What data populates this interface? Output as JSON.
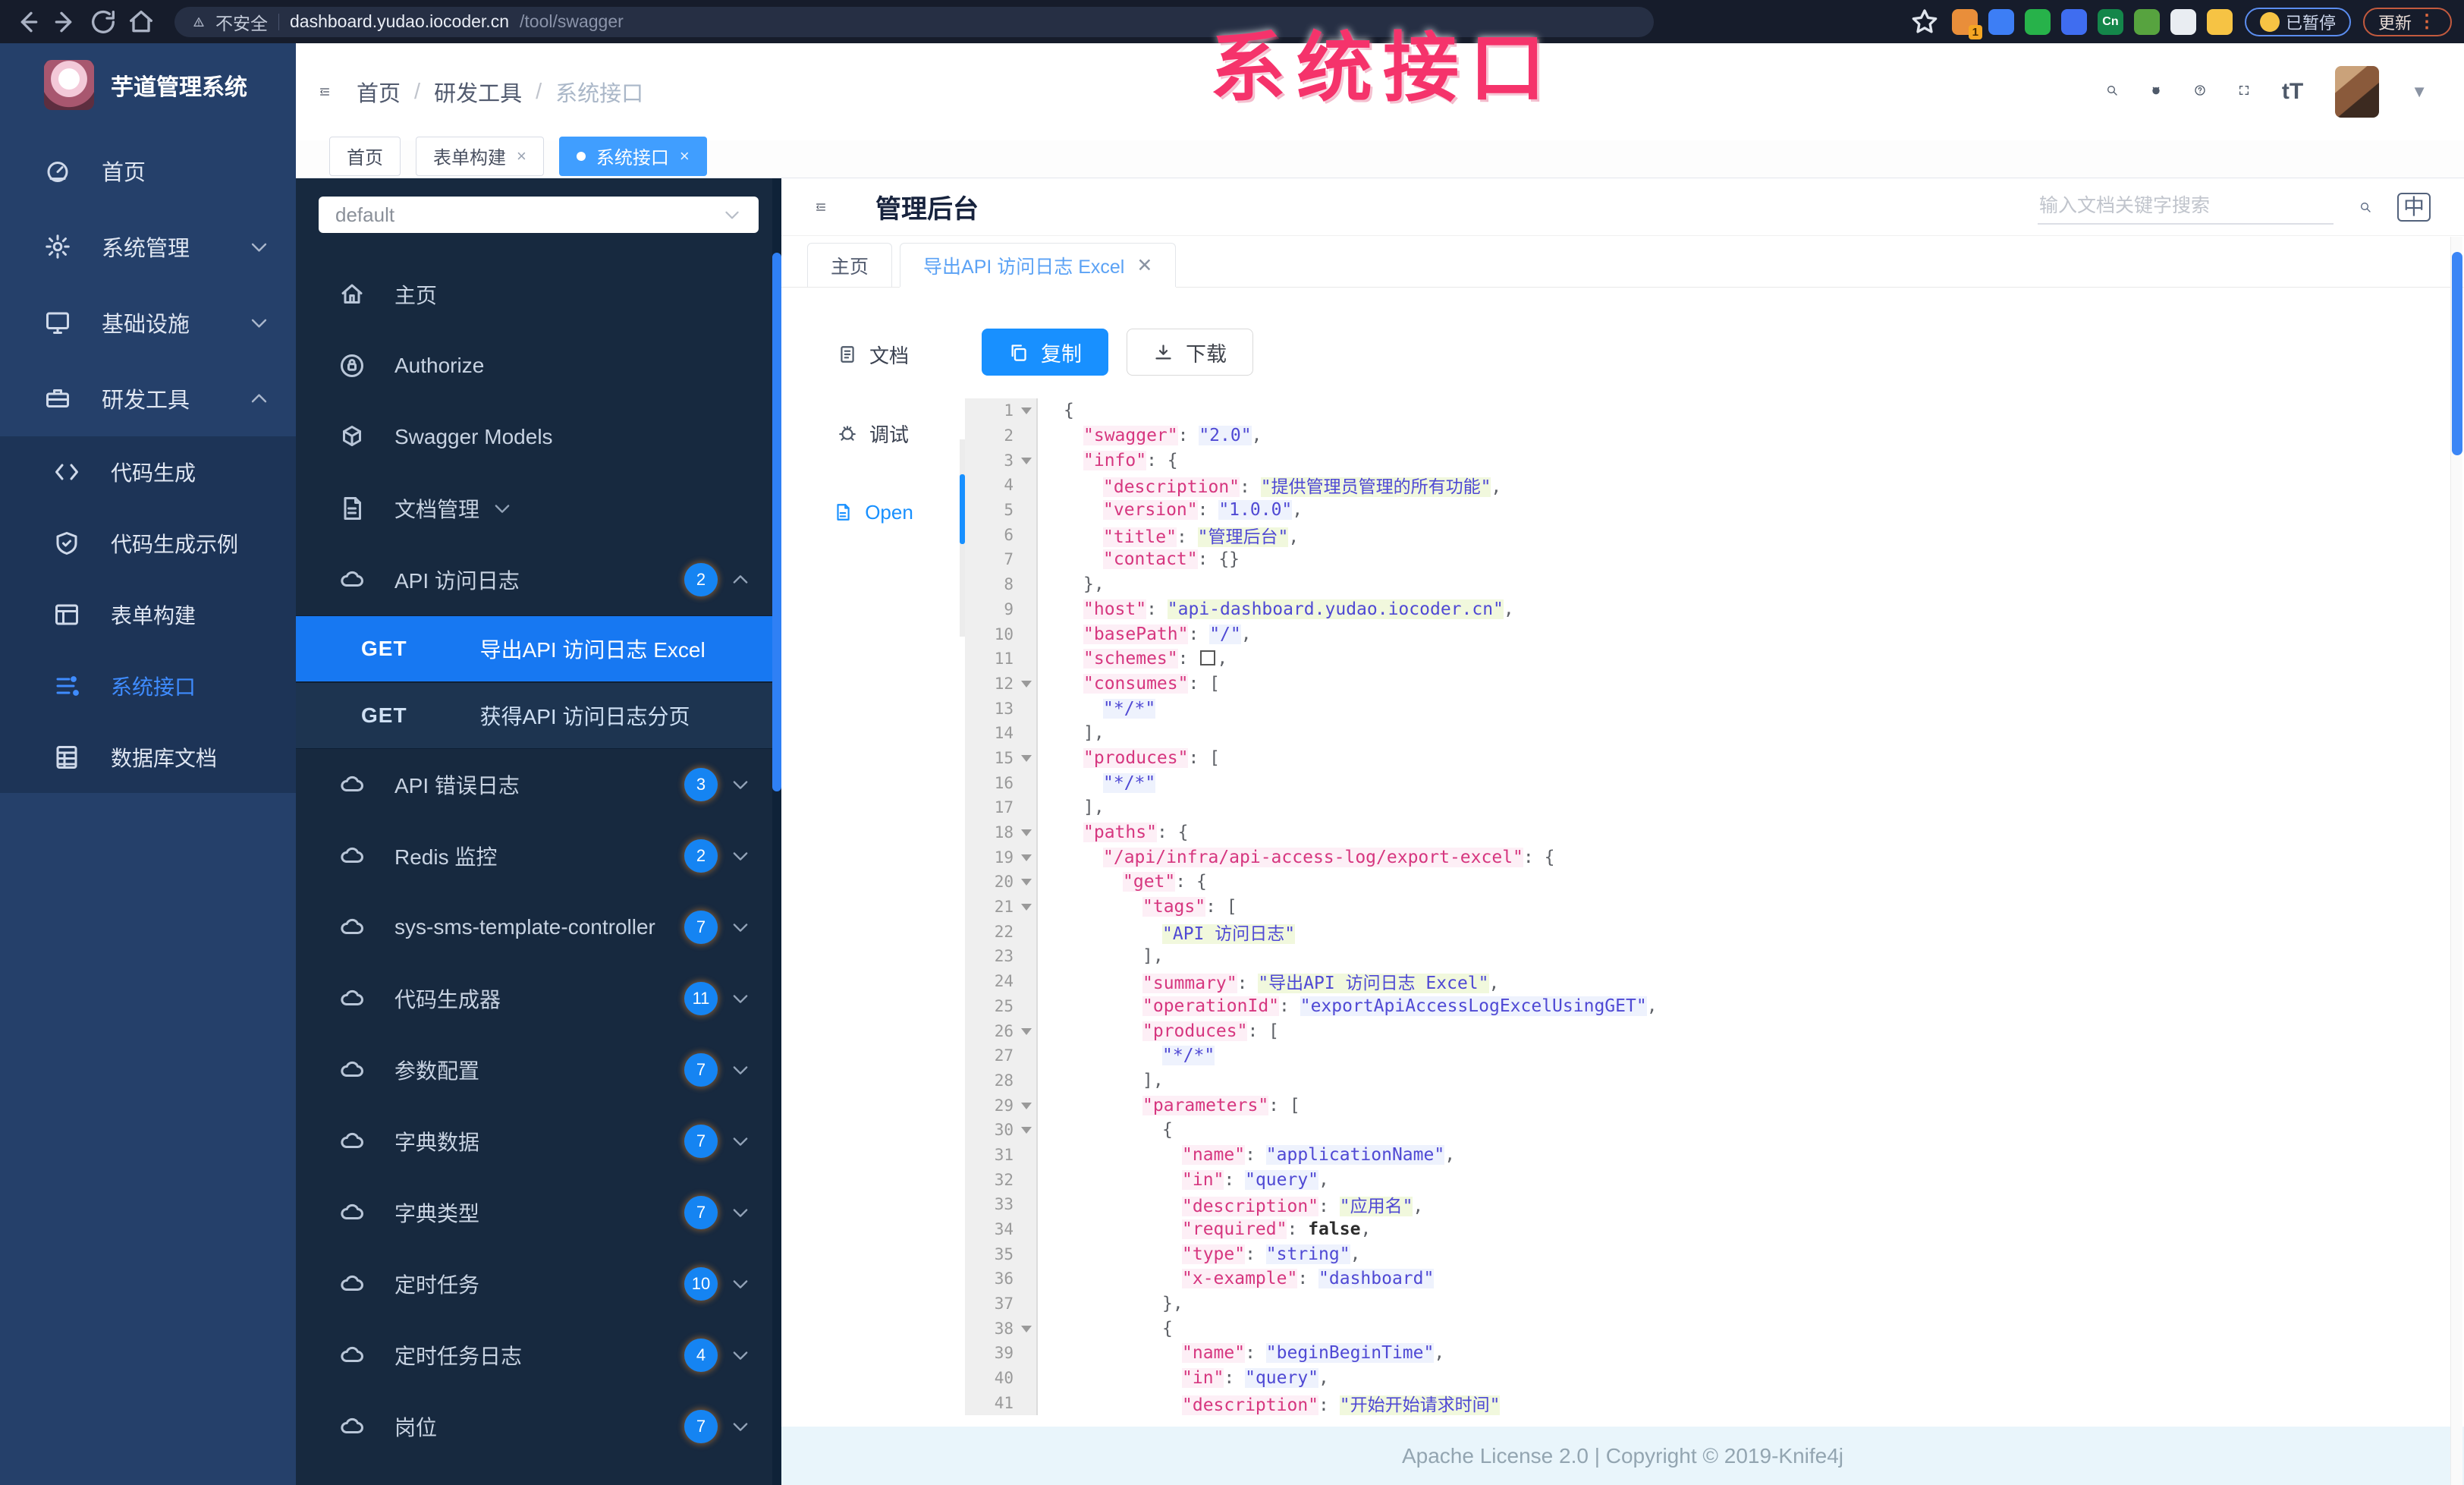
{
  "browser": {
    "security_label": "不安全",
    "url_host": "dashboard.yudao.iocoder.cn",
    "url_path": "/tool/swagger",
    "paused_label": "已暂停",
    "update_label": "更新",
    "extensions": [
      {
        "name": "ext-orange",
        "color": "#e98e3a",
        "badge": "1"
      },
      {
        "name": "ext-blue-drop",
        "color": "#3d7ef5"
      },
      {
        "name": "ext-green-circle",
        "color": "#27b24a"
      },
      {
        "name": "ext-blue-pair",
        "color": "#3f6df0"
      },
      {
        "name": "ext-green-cn",
        "color": "#14864a",
        "label": "Cn"
      },
      {
        "name": "ext-green-leaf",
        "color": "#57a33f"
      },
      {
        "name": "ext-white-star",
        "color": "#e9edf2"
      },
      {
        "name": "ext-emoji",
        "color": "#f6c344"
      }
    ]
  },
  "watermark": "系统接口",
  "app_sidebar": {
    "title": "芋道管理系统",
    "items": [
      {
        "icon": "dashboard-icon",
        "label": "首页"
      },
      {
        "icon": "gear-icon",
        "label": "系统管理",
        "chevron": "down"
      },
      {
        "icon": "monitor-icon",
        "label": "基础设施",
        "chevron": "down"
      },
      {
        "icon": "toolbox-icon",
        "label": "研发工具",
        "chevron": "up"
      }
    ],
    "subitems": [
      {
        "icon": "code-icon",
        "label": "代码生成"
      },
      {
        "icon": "shield-icon",
        "label": "代码生成示例"
      },
      {
        "icon": "form-icon",
        "label": "表单构建"
      },
      {
        "icon": "api-icon",
        "label": "系统接口",
        "active": true
      },
      {
        "icon": "db-icon",
        "label": "数据库文档"
      }
    ]
  },
  "topbar": {
    "breadcrumb": [
      "首页",
      "研发工具",
      "系统接口"
    ]
  },
  "tag_tabs": [
    {
      "label": "首页"
    },
    {
      "label": "表单构建",
      "closable": true
    },
    {
      "label": "系统接口",
      "closable": true,
      "active": true
    }
  ],
  "swagger_sidebar": {
    "group_value": "default",
    "items": [
      {
        "type": "link",
        "icon": "home-icon",
        "label": "主页"
      },
      {
        "type": "link",
        "icon": "lock-icon",
        "label": "Authorize"
      },
      {
        "type": "link",
        "icon": "models-icon",
        "label": "Swagger Models"
      },
      {
        "type": "group",
        "icon": "docs-icon",
        "label": "文档管理",
        "chevron": "down"
      },
      {
        "type": "group",
        "icon": "cloud-icon",
        "label": "API 访问日志",
        "badge": "2",
        "chevron": "up"
      },
      {
        "type": "op",
        "method": "GET",
        "label": "导出API 访问日志 Excel",
        "active": true
      },
      {
        "type": "op",
        "method": "GET",
        "label": "获得API 访问日志分页"
      },
      {
        "type": "group",
        "icon": "cloud-icon",
        "label": "API 错误日志",
        "badge": "3",
        "chevron": "down"
      },
      {
        "type": "group",
        "icon": "cloud-icon",
        "label": "Redis 监控",
        "badge": "2",
        "chevron": "down"
      },
      {
        "type": "group",
        "icon": "cloud-icon",
        "label": "sys-sms-template-controller",
        "badge": "7",
        "chevron": "down"
      },
      {
        "type": "group",
        "icon": "cloud-icon",
        "label": "代码生成器",
        "badge": "11",
        "chevron": "down"
      },
      {
        "type": "group",
        "icon": "cloud-icon",
        "label": "参数配置",
        "badge": "7",
        "chevron": "down"
      },
      {
        "type": "group",
        "icon": "cloud-icon",
        "label": "字典数据",
        "badge": "7",
        "chevron": "down"
      },
      {
        "type": "group",
        "icon": "cloud-icon",
        "label": "字典类型",
        "badge": "7",
        "chevron": "down"
      },
      {
        "type": "group",
        "icon": "cloud-icon",
        "label": "定时任务",
        "badge": "10",
        "chevron": "down"
      },
      {
        "type": "group",
        "icon": "cloud-icon",
        "label": "定时任务日志",
        "badge": "4",
        "chevron": "down"
      },
      {
        "type": "group",
        "icon": "cloud-icon",
        "label": "岗位",
        "badge": "7",
        "chevron": "down"
      }
    ]
  },
  "doc_header": {
    "title": "管理后台",
    "search_placeholder": "输入文档关键字搜索",
    "lang_label": "中"
  },
  "doc_tabs": [
    {
      "label": "主页"
    },
    {
      "label": "导出API 访问日志 Excel",
      "closable": true,
      "active": true
    }
  ],
  "mini_tabs": [
    {
      "icon": "docpage-icon",
      "label": "文档"
    },
    {
      "icon": "bug-icon",
      "label": "调试"
    },
    {
      "icon": "openfile-icon",
      "label": "Open",
      "active": true
    }
  ],
  "toolbar": {
    "copy_label": "复制",
    "download_label": "下载"
  },
  "code": {
    "fold_lines": [
      1,
      3,
      12,
      15,
      18,
      19,
      20,
      21,
      26,
      29,
      30,
      38
    ],
    "lines": [
      {
        "n": 1,
        "i": 0,
        "t": [
          [
            "p",
            "{"
          ]
        ]
      },
      {
        "n": 2,
        "i": 1,
        "t": [
          [
            "k",
            "\"swagger\""
          ],
          [
            "p",
            ": "
          ],
          [
            "v",
            "\"2.0\""
          ],
          [
            "p",
            ","
          ]
        ]
      },
      {
        "n": 3,
        "i": 1,
        "t": [
          [
            "k",
            "\"info\""
          ],
          [
            "p",
            ": {"
          ]
        ]
      },
      {
        "n": 4,
        "i": 2,
        "t": [
          [
            "k",
            "\"description\""
          ],
          [
            "p",
            ": "
          ],
          [
            "c",
            "\"提供管理员管理的所有功能\""
          ],
          [
            "p",
            ","
          ]
        ]
      },
      {
        "n": 5,
        "i": 2,
        "t": [
          [
            "k",
            "\"version\""
          ],
          [
            "p",
            ": "
          ],
          [
            "v",
            "\"1.0.0\""
          ],
          [
            "p",
            ","
          ]
        ]
      },
      {
        "n": 6,
        "i": 2,
        "t": [
          [
            "k",
            "\"title\""
          ],
          [
            "p",
            ": "
          ],
          [
            "c",
            "\"管理后台\""
          ],
          [
            "p",
            ","
          ]
        ]
      },
      {
        "n": 7,
        "i": 2,
        "t": [
          [
            "k",
            "\"contact\""
          ],
          [
            "p",
            ": {}"
          ]
        ]
      },
      {
        "n": 8,
        "i": 1,
        "t": [
          [
            "p",
            "},"
          ]
        ]
      },
      {
        "n": 9,
        "i": 1,
        "t": [
          [
            "k",
            "\"host\""
          ],
          [
            "p",
            ": "
          ],
          [
            "c",
            "\"api-dashboard.yudao.iocoder.cn\""
          ],
          [
            "p",
            ","
          ]
        ]
      },
      {
        "n": 10,
        "i": 1,
        "t": [
          [
            "k",
            "\"basePath\""
          ],
          [
            "p",
            ": "
          ],
          [
            "v",
            "\"/\""
          ],
          [
            "p",
            ","
          ]
        ]
      },
      {
        "n": 11,
        "i": 1,
        "t": [
          [
            "k",
            "\"schemes\""
          ],
          [
            "p",
            ": "
          ],
          [
            "box",
            ""
          ],
          [
            "p",
            ","
          ]
        ]
      },
      {
        "n": 12,
        "i": 1,
        "t": [
          [
            "k",
            "\"consumes\""
          ],
          [
            "p",
            ": ["
          ]
        ]
      },
      {
        "n": 13,
        "i": 2,
        "t": [
          [
            "v",
            "\"*/*\""
          ]
        ]
      },
      {
        "n": 14,
        "i": 1,
        "t": [
          [
            "p",
            "],"
          ]
        ]
      },
      {
        "n": 15,
        "i": 1,
        "t": [
          [
            "k",
            "\"produces\""
          ],
          [
            "p",
            ": ["
          ]
        ]
      },
      {
        "n": 16,
        "i": 2,
        "t": [
          [
            "v",
            "\"*/*\""
          ]
        ]
      },
      {
        "n": 17,
        "i": 1,
        "t": [
          [
            "p",
            "],"
          ]
        ]
      },
      {
        "n": 18,
        "i": 1,
        "t": [
          [
            "k",
            "\"paths\""
          ],
          [
            "p",
            ": {"
          ]
        ]
      },
      {
        "n": 19,
        "i": 2,
        "t": [
          [
            "k",
            "\"/api/infra/api-access-log/export-excel\""
          ],
          [
            "p",
            ": {"
          ]
        ]
      },
      {
        "n": 20,
        "i": 3,
        "t": [
          [
            "k",
            "\"get\""
          ],
          [
            "p",
            ": {"
          ]
        ]
      },
      {
        "n": 21,
        "i": 4,
        "t": [
          [
            "k",
            "\"tags\""
          ],
          [
            "p",
            ": ["
          ]
        ]
      },
      {
        "n": 22,
        "i": 5,
        "t": [
          [
            "c",
            "\"API 访问日志\""
          ]
        ]
      },
      {
        "n": 23,
        "i": 4,
        "t": [
          [
            "p",
            "],"
          ]
        ]
      },
      {
        "n": 24,
        "i": 4,
        "t": [
          [
            "k",
            "\"summary\""
          ],
          [
            "p",
            ": "
          ],
          [
            "c",
            "\"导出API 访问日志 Excel\""
          ],
          [
            "p",
            ","
          ]
        ]
      },
      {
        "n": 25,
        "i": 4,
        "t": [
          [
            "k",
            "\"operationId\""
          ],
          [
            "p",
            ": "
          ],
          [
            "v",
            "\"exportApiAccessLogExcelUsingGET\""
          ],
          [
            "p",
            ","
          ]
        ]
      },
      {
        "n": 26,
        "i": 4,
        "t": [
          [
            "k",
            "\"produces\""
          ],
          [
            "p",
            ": ["
          ]
        ]
      },
      {
        "n": 27,
        "i": 5,
        "t": [
          [
            "v",
            "\"*/*\""
          ]
        ]
      },
      {
        "n": 28,
        "i": 4,
        "t": [
          [
            "p",
            "],"
          ]
        ]
      },
      {
        "n": 29,
        "i": 4,
        "t": [
          [
            "k",
            "\"parameters\""
          ],
          [
            "p",
            ": ["
          ]
        ]
      },
      {
        "n": 30,
        "i": 5,
        "t": [
          [
            "p",
            "{"
          ]
        ]
      },
      {
        "n": 31,
        "i": 6,
        "t": [
          [
            "k",
            "\"name\""
          ],
          [
            "p",
            ": "
          ],
          [
            "v",
            "\"applicationName\""
          ],
          [
            "p",
            ","
          ]
        ]
      },
      {
        "n": 32,
        "i": 6,
        "t": [
          [
            "k",
            "\"in\""
          ],
          [
            "p",
            ": "
          ],
          [
            "v",
            "\"query\""
          ],
          [
            "p",
            ","
          ]
        ]
      },
      {
        "n": 33,
        "i": 6,
        "t": [
          [
            "k",
            "\"description\""
          ],
          [
            "p",
            ": "
          ],
          [
            "c",
            "\"应用名\""
          ],
          [
            "p",
            ","
          ]
        ]
      },
      {
        "n": 34,
        "i": 6,
        "t": [
          [
            "k",
            "\"required\""
          ],
          [
            "p",
            ": "
          ],
          [
            "b",
            "false"
          ],
          [
            "p",
            ","
          ]
        ]
      },
      {
        "n": 35,
        "i": 6,
        "t": [
          [
            "k",
            "\"type\""
          ],
          [
            "p",
            ": "
          ],
          [
            "v",
            "\"string\""
          ],
          [
            "p",
            ","
          ]
        ]
      },
      {
        "n": 36,
        "i": 6,
        "t": [
          [
            "k",
            "\"x-example\""
          ],
          [
            "p",
            ": "
          ],
          [
            "v",
            "\"dashboard\""
          ]
        ]
      },
      {
        "n": 37,
        "i": 5,
        "t": [
          [
            "p",
            "},"
          ]
        ]
      },
      {
        "n": 38,
        "i": 5,
        "t": [
          [
            "p",
            "{"
          ]
        ]
      },
      {
        "n": 39,
        "i": 6,
        "t": [
          [
            "k",
            "\"name\""
          ],
          [
            "p",
            ": "
          ],
          [
            "v",
            "\"beginBeginTime\""
          ],
          [
            "p",
            ","
          ]
        ]
      },
      {
        "n": 40,
        "i": 6,
        "t": [
          [
            "k",
            "\"in\""
          ],
          [
            "p",
            ": "
          ],
          [
            "v",
            "\"query\""
          ],
          [
            "p",
            ","
          ]
        ]
      },
      {
        "n": 41,
        "i": 6,
        "t": [
          [
            "k",
            "\"description\""
          ],
          [
            "p",
            ": "
          ],
          [
            "c",
            "\"开始开始请求时间\""
          ]
        ]
      }
    ]
  },
  "footer": {
    "text": "Apache License 2.0 | Copyright © 2019-Knife4j"
  },
  "colors": {
    "accent": "#1890ff",
    "selected_row": "#1778f2",
    "sidebar": "#25406a",
    "sw_sidebar": "#17293f",
    "watermark": "#f5336b"
  }
}
